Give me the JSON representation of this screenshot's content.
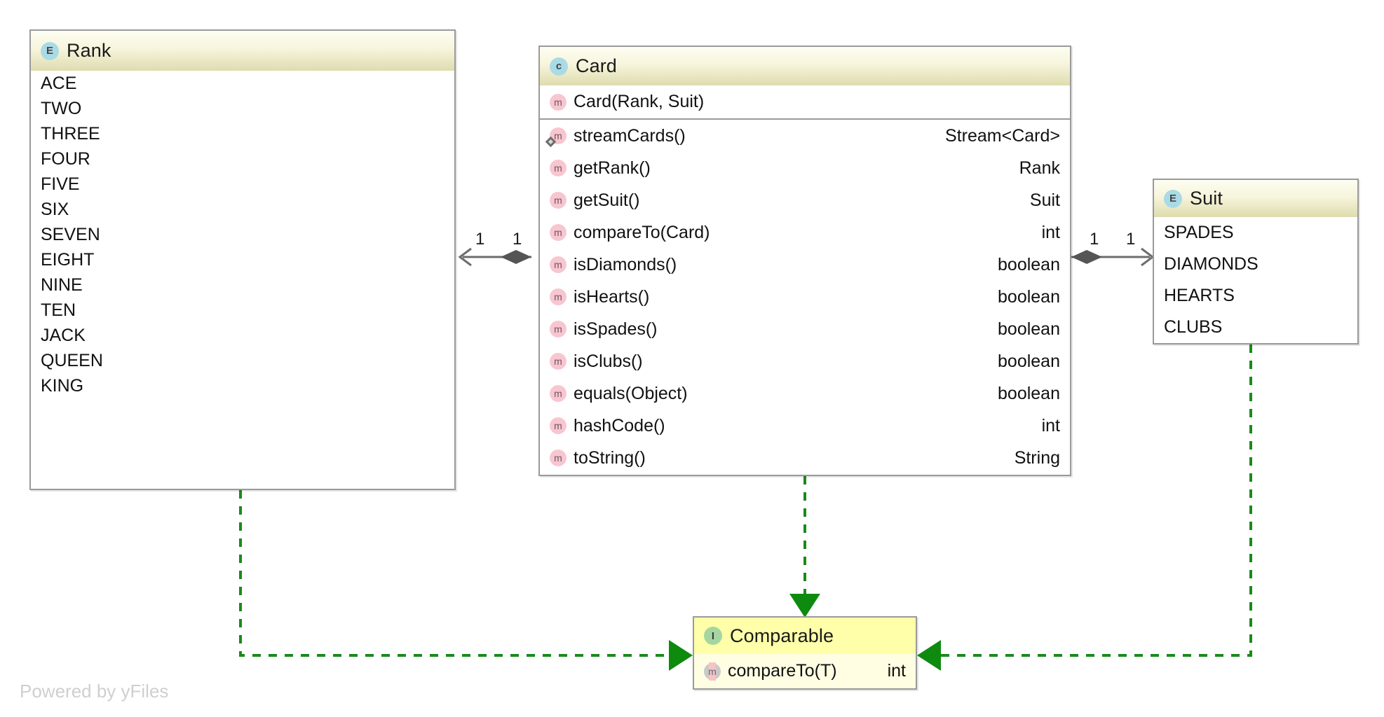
{
  "diagram": {
    "kind": "uml-class-diagram",
    "watermark": "Powered by yFiles",
    "colors": {
      "node_border": "#9a9a9a",
      "header_gradient_top": "#fdfdf2",
      "header_gradient_bottom": "#dedcae",
      "interface_header": "#ffffaa",
      "interface_body": "#fffee3",
      "enum_badge": "#a9dbe6",
      "class_badge": "#a9dbe6",
      "interface_badge": "#a5d6a0",
      "member_badge": "#f8c6d0",
      "realization_edge": "#1a8a1a",
      "association_edge": "#6d6d6d"
    }
  },
  "nodes": {
    "rank": {
      "stereotype_glyph": "E",
      "stereotype": "enum",
      "title": "Rank",
      "literals": [
        "ACE",
        "TWO",
        "THREE",
        "FOUR",
        "FIVE",
        "SIX",
        "SEVEN",
        "EIGHT",
        "NINE",
        "TEN",
        "JACK",
        "QUEEN",
        "KING"
      ]
    },
    "card": {
      "stereotype_glyph": "c",
      "stereotype": "class",
      "title": "Card",
      "constructors": [
        {
          "glyph": "m",
          "name": "Card(Rank, Suit)",
          "type": "",
          "static": false
        }
      ],
      "methods": [
        {
          "glyph": "m",
          "name": "streamCards()",
          "type": "Stream<Card>",
          "static": true
        },
        {
          "glyph": "m",
          "name": "getRank()",
          "type": "Rank",
          "static": false
        },
        {
          "glyph": "m",
          "name": "getSuit()",
          "type": "Suit",
          "static": false
        },
        {
          "glyph": "m",
          "name": "compareTo(Card)",
          "type": "int",
          "static": false
        },
        {
          "glyph": "m",
          "name": "isDiamonds()",
          "type": "boolean",
          "static": false
        },
        {
          "glyph": "m",
          "name": "isHearts()",
          "type": "boolean",
          "static": false
        },
        {
          "glyph": "m",
          "name": "isSpades()",
          "type": "boolean",
          "static": false
        },
        {
          "glyph": "m",
          "name": "isClubs()",
          "type": "boolean",
          "static": false
        },
        {
          "glyph": "m",
          "name": "equals(Object)",
          "type": "boolean",
          "static": false
        },
        {
          "glyph": "m",
          "name": "hashCode()",
          "type": "int",
          "static": false
        },
        {
          "glyph": "m",
          "name": "toString()",
          "type": "String",
          "static": false
        }
      ]
    },
    "suit": {
      "stereotype_glyph": "E",
      "stereotype": "enum",
      "title": "Suit",
      "literals": [
        "SPADES",
        "DIAMONDS",
        "HEARTS",
        "CLUBS"
      ]
    },
    "comparable": {
      "stereotype_glyph": "I",
      "stereotype": "interface",
      "title": "Comparable",
      "methods": [
        {
          "glyph": "m",
          "name": "compareTo(T)",
          "type": "int",
          "abstract": true
        }
      ]
    }
  },
  "edges": {
    "card_rank": {
      "type": "aggregation",
      "source": "Card",
      "target": "Rank",
      "source_multiplicity": "1",
      "target_multiplicity": "1"
    },
    "card_suit": {
      "type": "aggregation",
      "source": "Card",
      "target": "Suit",
      "source_multiplicity": "1",
      "target_multiplicity": "1"
    },
    "card_comparable": {
      "type": "realization",
      "source": "Card",
      "target": "Comparable"
    },
    "rank_comparable": {
      "type": "realization",
      "source": "Rank",
      "target": "Comparable"
    },
    "suit_comparable": {
      "type": "realization",
      "source": "Suit",
      "target": "Comparable"
    }
  }
}
